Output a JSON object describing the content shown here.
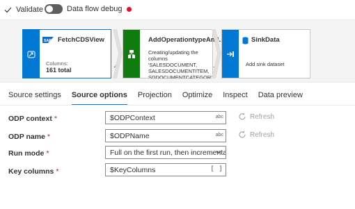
{
  "toolbar": {
    "validate_label": "Validate",
    "debug_label": "Data flow debug",
    "debug_status_color": "#e81123"
  },
  "canvas": {
    "nodes": [
      {
        "title": "FetchCDSView",
        "icon": "sap-source-icon",
        "sub_label": "Columns:",
        "sub_value": "161 total"
      },
      {
        "title": "AddOperationtypeAnd...",
        "icon": "derived-column-icon",
        "description": "Creating/updating the columns 'SALESDOCUMENT, SALESDOCUMENTITEM, SDDOCUMENTCATEGORY, SALESDOCUMENTTYPE"
      },
      {
        "title": "SinkData",
        "icon": "sink-database-icon",
        "description": "Add sink dataset"
      }
    ],
    "plus_label": "+"
  },
  "tabs": [
    {
      "label": "Source settings",
      "active": false
    },
    {
      "label": "Source options",
      "active": true
    },
    {
      "label": "Projection",
      "active": false
    },
    {
      "label": "Optimize",
      "active": false
    },
    {
      "label": "Inspect",
      "active": false
    },
    {
      "label": "Data preview",
      "active": false
    }
  ],
  "form": {
    "required_mark": "*",
    "odp_context": {
      "label": "ODP context",
      "value": "$ODPContext",
      "type_badge": "abc",
      "refresh_label": "Refresh"
    },
    "odp_name": {
      "label": "ODP name",
      "value": "$ODPName",
      "type_badge": "abc",
      "refresh_label": "Refresh"
    },
    "run_mode": {
      "label": "Run mode",
      "value": "Full on the first run, then incremental"
    },
    "key_columns": {
      "label": "Key columns",
      "value": "$KeyColumns",
      "type_badge": "[ ]"
    }
  },
  "colors": {
    "accent": "#0078d4",
    "transform": "#107c10",
    "required": "#a4262c"
  }
}
